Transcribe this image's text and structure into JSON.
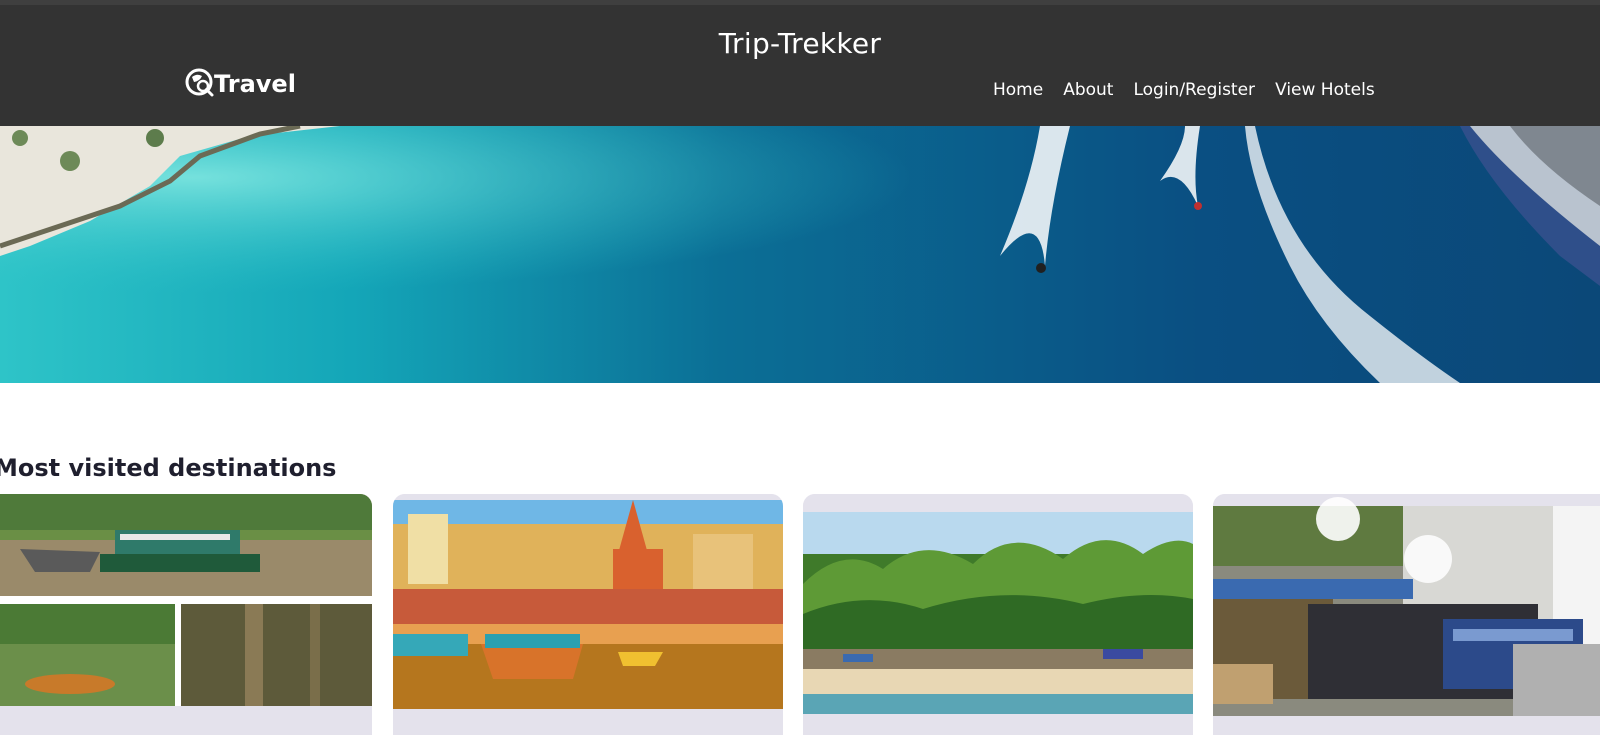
{
  "header": {
    "site_title": "Trip-Trekker",
    "logo_text": "Travel",
    "logo_icon": "globe-search-icon"
  },
  "nav": {
    "items": [
      {
        "label": "Home"
      },
      {
        "label": "About"
      },
      {
        "label": "Login/Register"
      },
      {
        "label": "View Hotels"
      }
    ]
  },
  "main": {
    "section_title": "Most visited destinations"
  },
  "colors": {
    "header_bg": "#333333",
    "card_bg": "#e4e2ec",
    "title_text": "#1f1f2e"
  }
}
